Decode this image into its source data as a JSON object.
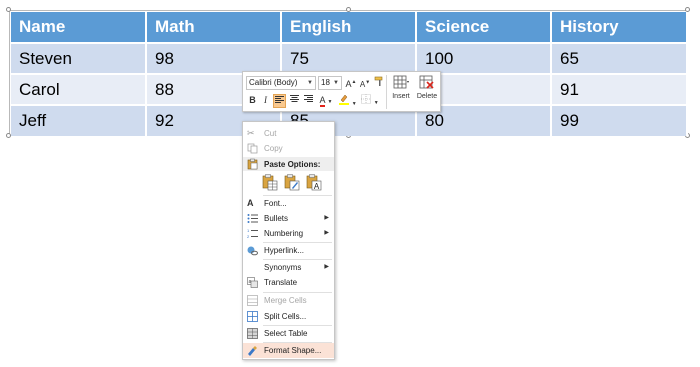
{
  "table": {
    "headers": [
      "Name",
      "Math",
      "English",
      "Science",
      "History"
    ],
    "rows": [
      [
        "Steven",
        "98",
        "75",
        "100",
        "65"
      ],
      [
        "Carol",
        "88",
        "",
        "",
        "91"
      ],
      [
        "Jeff",
        "92",
        "85",
        "80",
        "99"
      ]
    ]
  },
  "mini_toolbar": {
    "font_name": "Calibri (Body)",
    "font_size": "18",
    "insert_label": "Insert",
    "delete_label": "Delete",
    "bold": "B",
    "italic": "I"
  },
  "context_menu": {
    "cut": "Cut",
    "copy": "Copy",
    "paste_options": "Paste Options:",
    "font": "Font...",
    "bullets": "Bullets",
    "numbering": "Numbering",
    "hyperlink": "Hyperlink...",
    "synonyms": "Synonyms",
    "translate": "Translate",
    "merge_cells": "Merge Cells",
    "split_cells": "Split Cells...",
    "select_table": "Select Table",
    "format_shape": "Format Shape..."
  },
  "colors": {
    "header_bg": "#5b9bd5",
    "row_odd": "#cfdbee",
    "row_even": "#e8edf6",
    "menu_hover": "#fbe2d6",
    "font_color_red": "#e2231a",
    "highlight_yellow": "#ffff00"
  }
}
